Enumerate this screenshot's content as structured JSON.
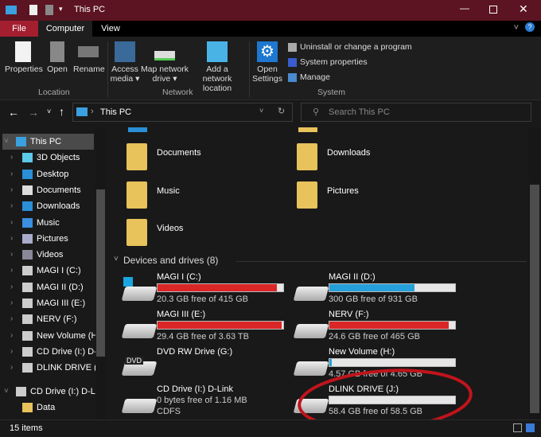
{
  "window": {
    "title": "This PC",
    "accent": "#5c1422",
    "controls": [
      "minimize",
      "maximize",
      "close"
    ]
  },
  "tabs": [
    {
      "label": "File"
    },
    {
      "label": "Computer"
    },
    {
      "label": "View"
    }
  ],
  "ribbon": {
    "location": {
      "label": "Location",
      "buttons": [
        {
          "label": "Properties"
        },
        {
          "label": "Open"
        },
        {
          "label": "Rename"
        }
      ]
    },
    "network": {
      "label": "Network",
      "buttons": [
        {
          "label": "Access media ▾"
        },
        {
          "label": "Map network drive ▾"
        },
        {
          "label": "Add a network location"
        }
      ]
    },
    "system": {
      "label": "System",
      "open_settings": "Open Settings",
      "items": [
        {
          "label": "Uninstall or change a program"
        },
        {
          "label": "System properties"
        },
        {
          "label": "Manage"
        }
      ]
    }
  },
  "address": {
    "path": "This PC",
    "search_placeholder": "Search This PC"
  },
  "sidebar": {
    "items": [
      {
        "label": "This PC",
        "expanded": true
      },
      {
        "label": "3D Objects"
      },
      {
        "label": "Desktop"
      },
      {
        "label": "Documents"
      },
      {
        "label": "Downloads"
      },
      {
        "label": "Music"
      },
      {
        "label": "Pictures"
      },
      {
        "label": "Videos"
      },
      {
        "label": "MAGI I (C:)"
      },
      {
        "label": "MAGI II (D:)"
      },
      {
        "label": "MAGI III (E:)"
      },
      {
        "label": "NERV (F:)"
      },
      {
        "label": "New Volume (H:"
      },
      {
        "label": "CD Drive (I:) D-L"
      },
      {
        "label": "DLINK DRIVE (J:)"
      },
      {
        "label": "CD Drive (I:) D-Lin",
        "expanded": true
      },
      {
        "label": "Data"
      }
    ]
  },
  "folders": [
    {
      "label": "Documents"
    },
    {
      "label": "Downloads"
    },
    {
      "label": "Music"
    },
    {
      "label": "Pictures"
    },
    {
      "label": "Videos"
    }
  ],
  "devices": {
    "header": "Devices and drives (8)",
    "drives": [
      {
        "name": "MAGI I (C:)",
        "info": "20.3 GB free of 415 GB",
        "used_pct": 95,
        "color": "#da2626"
      },
      {
        "name": "MAGI II (D:)",
        "info": "300 GB free of 931 GB",
        "used_pct": 68,
        "color": "#26a0da"
      },
      {
        "name": "MAGI III (E:)",
        "info": "29.4 GB free of 3.63 TB",
        "used_pct": 99,
        "color": "#da2626"
      },
      {
        "name": "NERV (F:)",
        "info": "24.6 GB free of 465 GB",
        "used_pct": 95,
        "color": "#da2626"
      },
      {
        "name": "DVD RW Drive (G:)",
        "label": "DVD"
      },
      {
        "name": "New Volume (H:)",
        "info": "4.57 GB free of 4.65 GB",
        "used_pct": 2,
        "color": "#26a0da"
      },
      {
        "name": "CD Drive (I:) D-Link",
        "info": "0 bytes free of 1.16 MB",
        "info2": "CDFS"
      },
      {
        "name": "DLINK DRIVE (J:)",
        "info": "58.4 GB free of 58.5 GB",
        "used_pct": 0,
        "color": "#26a0da",
        "highlighted": true
      }
    ]
  },
  "status": {
    "items": "15 items"
  }
}
